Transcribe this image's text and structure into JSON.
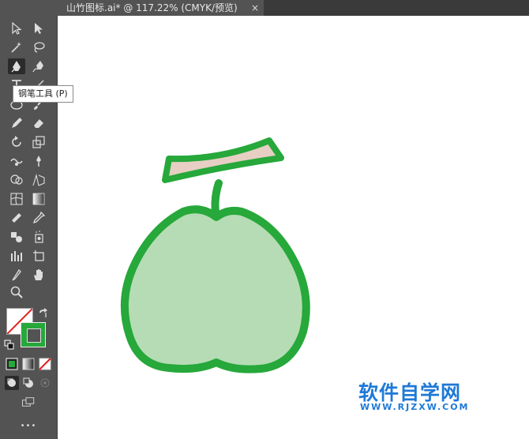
{
  "document_tab": {
    "title": "山竹图标.ai* @ 117.22% (CMYK/预览)",
    "close_symbol": "×"
  },
  "tooltip": {
    "text": "钢笔工具 (P)"
  },
  "watermark": {
    "name": "软件自学网",
    "url": "WWW.RJZXW.COM",
    "color": "#1e79d7"
  },
  "toolbar": {
    "more_label": "•••",
    "tools": [
      "selection-tool-icon",
      "direct-selection-tool-icon",
      "magic-wand-icon",
      "lasso-icon",
      "pen-tool-icon",
      "curvature-tool-icon",
      "type-tool-icon",
      "line-tool-icon",
      "ellipse-tool-icon",
      "paintbrush-icon",
      "pencil-icon",
      "eraser-icon",
      "rotate-icon",
      "scale-icon",
      "warp-icon",
      "puppet-warp-icon",
      "shape-builder-icon",
      "perspective-grid-icon",
      "mesh-icon",
      "gradient-icon",
      "eyedropper-icon",
      "measure-icon",
      "blend-icon",
      "symbol-sprayer-icon",
      "column-graph-icon",
      "artboard-icon",
      "slice-icon",
      "hand-icon",
      "zoom-icon"
    ]
  },
  "artwork": {
    "fill_color": "#b6dcb5",
    "stroke_color": "#26a83a",
    "stem_fill_color": "#e7cfc4"
  }
}
